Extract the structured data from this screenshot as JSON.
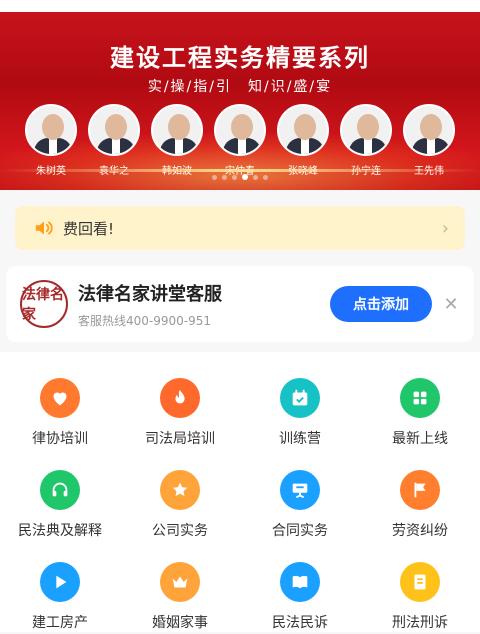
{
  "banner": {
    "title": "建设工程实务精要系列",
    "subtitle": "实/操/指/引　知/识/盛/宴",
    "speakers": [
      "朱树英",
      "袁华之",
      "韩如波",
      "宋仲春",
      "张晓峰",
      "孙宁连",
      "王先伟"
    ]
  },
  "notice": {
    "text": "费回看!",
    "icon": "speaker-icon"
  },
  "service": {
    "logo_text": "法律名家",
    "title": "法律名家讲堂客服",
    "phone": "客服热线400-9900-951",
    "add_label": "点击添加",
    "close_label": "✕"
  },
  "menu": [
    {
      "label": "律协培训",
      "icon": "heart-icon",
      "color": "#ff7a2e"
    },
    {
      "label": "司法局培训",
      "icon": "flame-icon",
      "color": "#ff6a2c"
    },
    {
      "label": "训练营",
      "icon": "calendar-icon",
      "color": "#16c2c6"
    },
    {
      "label": "最新上线",
      "icon": "grid-icon",
      "color": "#20c66a"
    },
    {
      "label": "民法典及解释",
      "icon": "headphones-icon",
      "color": "#20c66a"
    },
    {
      "label": "公司实务",
      "icon": "star-icon",
      "color": "#ffa43a"
    },
    {
      "label": "合同实务",
      "icon": "presentation-icon",
      "color": "#1aa0ff"
    },
    {
      "label": "劳资纠纷",
      "icon": "flag-icon",
      "color": "#ff7f2e"
    },
    {
      "label": "建工房产",
      "icon": "play-icon",
      "color": "#1aa0ff"
    },
    {
      "label": "婚姻家事",
      "icon": "crown-icon",
      "color": "#ffa43a"
    },
    {
      "label": "民法民诉",
      "icon": "book-icon",
      "color": "#1aa0ff"
    },
    {
      "label": "刑法刑诉",
      "icon": "notebook-icon",
      "color": "#ffc21a"
    }
  ]
}
